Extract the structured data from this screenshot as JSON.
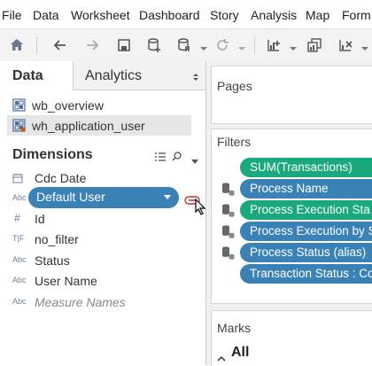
{
  "menu": {
    "items": [
      "File",
      "Data",
      "Worksheet",
      "Dashboard",
      "Story",
      "Analysis",
      "Map",
      "Form"
    ]
  },
  "toolbar": {
    "icons": [
      "home-icon",
      "back-icon",
      "forward-icon",
      "save-icon",
      "new-datasource-icon",
      "pause-updates-icon",
      "refresh-icon",
      "new-worksheet-icon",
      "duplicate-icon",
      "clear-icon"
    ]
  },
  "left_pane": {
    "tabs": {
      "data": "Data",
      "analytics": "Analytics"
    },
    "datasources": [
      {
        "name": "wb_overview",
        "selected": false
      },
      {
        "name": "wh_application_user",
        "selected": true
      }
    ],
    "dimensions_title": "Dimensions",
    "fields": [
      {
        "icon": "Abc",
        "icon_name": "calendar-abc-icon",
        "name": "Cdc Date"
      },
      {
        "icon": "",
        "icon_name": "hidden-by-drag",
        "name": ""
      },
      {
        "icon": "#",
        "icon_name": "number-icon",
        "name": "Id"
      },
      {
        "icon": "T|F",
        "icon_name": "boolean-icon",
        "name": "no_filter"
      },
      {
        "icon": "Abc",
        "icon_name": "string-icon",
        "name": "Status"
      },
      {
        "icon": "Abc",
        "icon_name": "string-icon",
        "name": "User Name"
      },
      {
        "icon": "Abc",
        "icon_name": "string-icon",
        "name": "Measure Names"
      }
    ],
    "dragged_pill": {
      "label": "Default User",
      "color": "#3a82b6"
    }
  },
  "right_pane": {
    "pages_title": "Pages",
    "filters_title": "Filters",
    "filters": [
      {
        "label": "SUM(Transactions)",
        "color": "#1aa87f",
        "db_icon": false
      },
      {
        "label": "Process Name",
        "color": "#3a82b6",
        "db_icon": true
      },
      {
        "label": "Process Execution Sta",
        "color": "#1aa87f",
        "db_icon": true
      },
      {
        "label": "Process Execution by S",
        "color": "#3a82b6",
        "db_icon": true
      },
      {
        "label": "Process Status (alias)",
        "color": "#3a82b6",
        "db_icon": true
      },
      {
        "label": "Transaction Status : Co",
        "color": "#3a82b6",
        "db_icon": false
      }
    ],
    "marks_title": "Marks",
    "marks_all": "All"
  },
  "colors": {
    "blue_pill": "#3a82b6",
    "green_pill": "#1aa87f",
    "drop_indicator": "#c8322f"
  }
}
